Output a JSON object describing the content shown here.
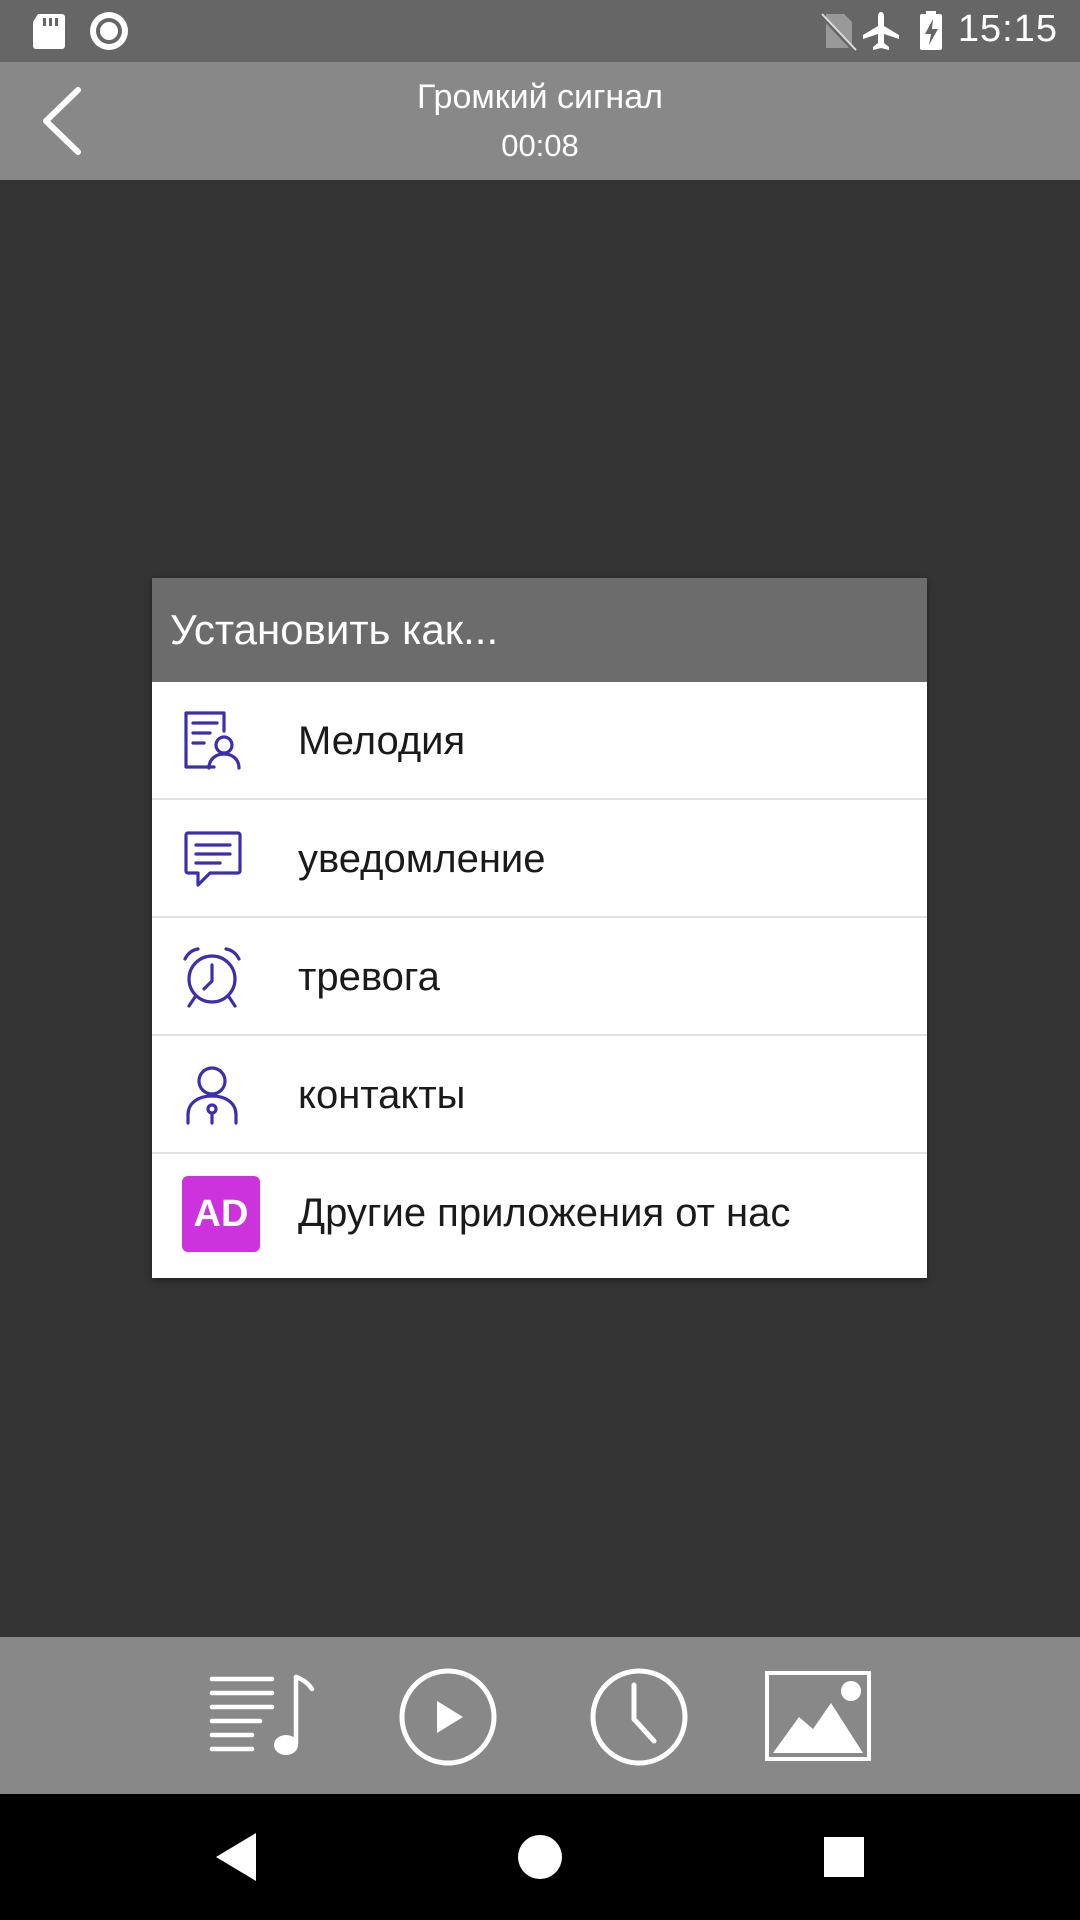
{
  "status_bar": {
    "time": "15:15",
    "icons": [
      "sd-card-icon",
      "record-icon",
      "no-sim-icon",
      "airplane-mode-icon",
      "battery-charging-icon"
    ]
  },
  "app_bar": {
    "title": "Громкий сигнал",
    "duration": "00:08",
    "back_icon": "chevron-left-icon"
  },
  "dialog": {
    "title": "Установить как...",
    "options": [
      {
        "label": "Мелодия",
        "icon": "ringtone-contact-icon"
      },
      {
        "label": "уведомление",
        "icon": "message-icon"
      },
      {
        "label": "тревога",
        "icon": "alarm-clock-icon"
      },
      {
        "label": "контакты",
        "icon": "contact-person-icon"
      },
      {
        "label": "Другие приложения от нас",
        "icon": "ad-badge",
        "badge_text": "AD"
      }
    ],
    "icon_color": "#3b2fb0",
    "ad_color": "#cc33dd"
  },
  "toolbar": {
    "buttons": [
      "playlist-icon",
      "play-icon",
      "clock-icon",
      "image-icon"
    ]
  },
  "nav_bar": {
    "buttons": [
      "back-triangle-icon",
      "home-circle-icon",
      "recents-square-icon"
    ]
  },
  "colors": {
    "background": "#333333",
    "status_bar": "#666666",
    "app_bar": "#888888",
    "dialog_header": "#6c6c6c",
    "nav_bar": "#000000"
  }
}
